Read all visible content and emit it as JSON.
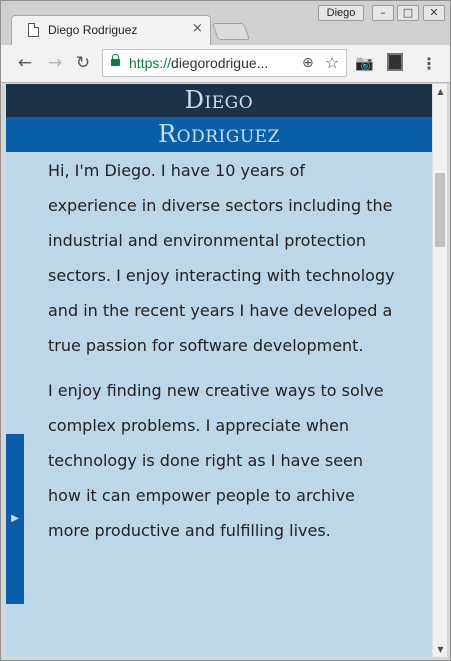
{
  "window": {
    "tab_title": "Diego Rodriguez",
    "tab_close": "×",
    "profile_name": "Diego",
    "minimize": "–",
    "maximize": "□",
    "close": "✕"
  },
  "toolbar": {
    "back": "←",
    "forward": "→",
    "reload": "↻",
    "url_scheme": "https://",
    "url_rest": "diegorodrigue...",
    "zoom_icon": "⊕",
    "star_icon": "☆",
    "camera_icon": "📷",
    "menu_icon": "⋮"
  },
  "page": {
    "header": {
      "first_name": "Diego",
      "last_name": "Rodriguez"
    },
    "paragraphs": [
      "Hi, I'm Diego. I have 10 years of experience in diverse sectors including the industrial and environmental protection sectors. I enjoy interacting with technology and in the recent years I have developed a true passion for software development.",
      "I enjoy finding new creative ways to solve complex problems. I appreciate when technology is done right as I have seen how it can empower people to archive more productive and fulfilling lives."
    ],
    "side_tab_arrow": "▶"
  },
  "scrollbar": {
    "up": "▲",
    "down": "▼"
  },
  "colors": {
    "header_dark": "#1c3249",
    "header_blue": "#0a5ea8",
    "page_bg": "#bbd7e8",
    "url_green": "#0b8043"
  }
}
